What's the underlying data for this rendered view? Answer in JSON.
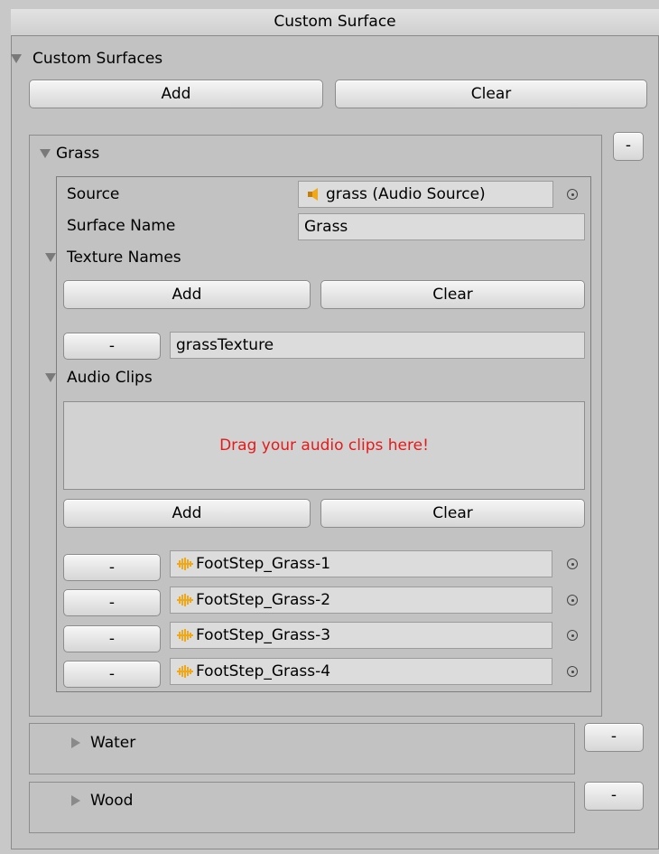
{
  "window_title": "Custom Surface",
  "custom_surfaces": {
    "label": "Custom Surfaces",
    "add_label": "Add",
    "clear_label": "Clear"
  },
  "surfaces": [
    {
      "name": "Grass",
      "expanded": true,
      "remove_label": "-",
      "source_label": "Source",
      "source_value": "grass (Audio Source)",
      "surface_name_label": "Surface Name",
      "surface_name_value": "Grass",
      "texture_names": {
        "label": "Texture Names",
        "add_label": "Add",
        "clear_label": "Clear",
        "items": [
          {
            "remove_label": "-",
            "value": "grassTexture"
          }
        ]
      },
      "audio_clips": {
        "label": "Audio Clips",
        "drop_text": "Drag your audio clips here!",
        "add_label": "Add",
        "clear_label": "Clear",
        "items": [
          {
            "remove_label": "-",
            "value": "FootStep_Grass-1"
          },
          {
            "remove_label": "-",
            "value": "FootStep_Grass-2"
          },
          {
            "remove_label": "-",
            "value": "FootStep_Grass-3"
          },
          {
            "remove_label": "-",
            "value": "FootStep_Grass-4"
          }
        ]
      }
    },
    {
      "name": "Water",
      "expanded": false,
      "remove_label": "-"
    },
    {
      "name": "Wood",
      "expanded": false,
      "remove_label": "-"
    }
  ],
  "colors": {
    "drop_text": "#e41a1a",
    "audio_icon": "#f0a818"
  }
}
